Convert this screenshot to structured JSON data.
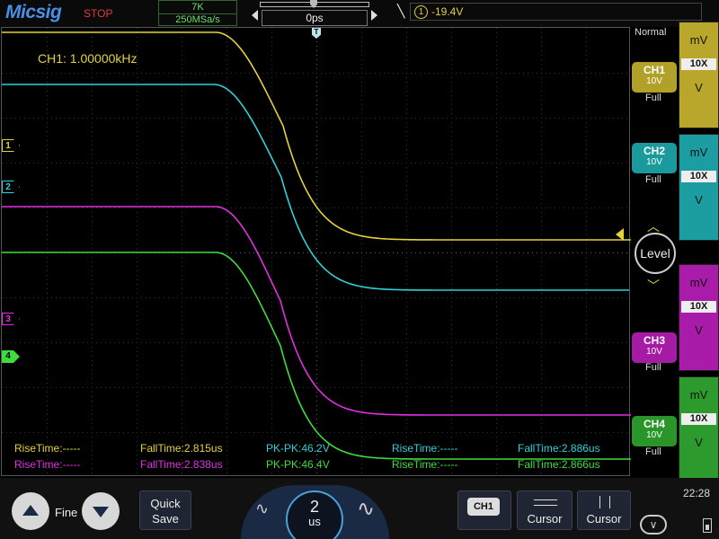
{
  "header": {
    "logo": "Micsig",
    "run_status": "STOP",
    "memory_depth": "7K",
    "sample_rate": "250MSa/s",
    "time_offset": "0ps",
    "trigger_source": "1",
    "trigger_level": "-19.4V"
  },
  "display": {
    "frequency_readout": "CH1: 1.00000kHz",
    "trigger_mode": "Normal",
    "channel_markers": [
      "1",
      "2",
      "3",
      "4"
    ]
  },
  "measurements": {
    "row1": [
      "RiseTime:-----",
      "FallTime:2.815us",
      "PK-PK:46.2V",
      "RiseTime:-----",
      "FallTime:2.886us"
    ],
    "row2": [
      "RiseTime:-----",
      "FallTime:2.838us",
      "PK-PK:46.4V",
      "RiseTime:-----",
      "FallTime:2.866us"
    ]
  },
  "channels": [
    {
      "name": "CH1",
      "volts_div": "10V",
      "bandwidth": "Full",
      "unit_top": "mV",
      "probe": "10X",
      "unit_bottom": "V",
      "color": "#c9b52a"
    },
    {
      "name": "CH2",
      "volts_div": "10V",
      "bandwidth": "Full",
      "unit_top": "mV",
      "probe": "10X",
      "unit_bottom": "V",
      "color": "#1fa3a8"
    },
    {
      "name": "CH3",
      "volts_div": "10V",
      "bandwidth": "Full",
      "unit_top": "mV",
      "probe": "10X",
      "unit_bottom": "V",
      "color": "#b51fb5"
    },
    {
      "name": "CH4",
      "volts_div": "10V",
      "bandwidth": "Full",
      "unit_top": "mV",
      "probe": "10X",
      "unit_bottom": "V",
      "color": "#2fa32f"
    }
  ],
  "trigger_knob_label": "Level",
  "bottom": {
    "fine_label": "Fine",
    "quick_save": [
      "Quick",
      "Save"
    ],
    "timebase_value": "2",
    "timebase_unit": "us",
    "ch_menu": "CH1",
    "cursor1_label": "Cursor",
    "cursor2_label": "Cursor",
    "clock": "22:28"
  },
  "colors": {
    "ch1": "#e5d23b",
    "ch2": "#2fd0d8",
    "ch3": "#e22fe2",
    "ch4": "#3fdc3f",
    "logo": "#4a90e8",
    "stop": "#e03a3a"
  }
}
